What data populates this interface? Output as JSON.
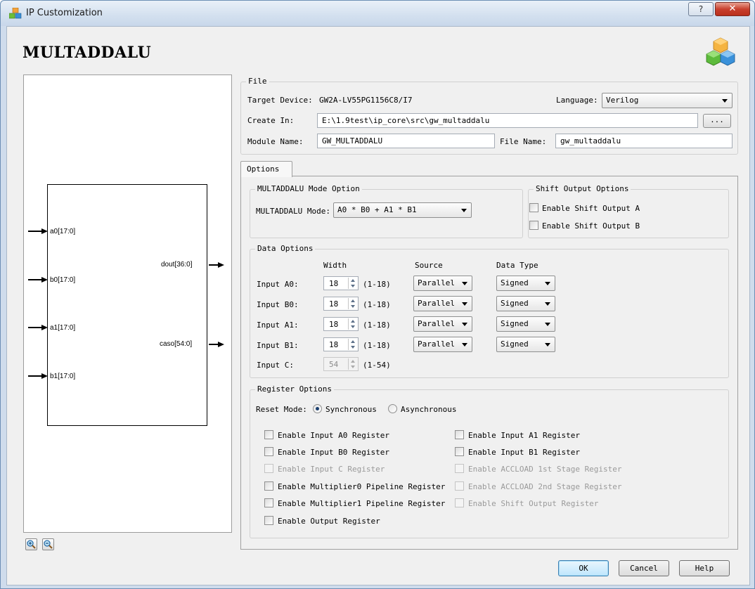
{
  "window": {
    "title": "IP Customization",
    "help_glyph": "?",
    "close_glyph": "✕",
    "icon": "ip-core-icon"
  },
  "header": {
    "title": "MULTADDALU",
    "logo_icon": "cubes-logo-icon"
  },
  "schematic": {
    "inputs": [
      "a0[17:0]",
      "b0[17:0]",
      "a1[17:0]",
      "b1[17:0]"
    ],
    "outputs": [
      "dout[36:0]",
      "caso[54:0]"
    ]
  },
  "file": {
    "group_title": "File",
    "target_device_label": "Target Device:",
    "target_device": "GW2A-LV55PG1156C8/I7",
    "language_label": "Language:",
    "language": "Verilog",
    "create_in_label": "Create In:",
    "create_in": "E:\\1.9test\\ip_core\\src\\gw_multaddalu",
    "browse_label": "...",
    "module_name_label": "Module Name:",
    "module_name": "GW_MULTADDALU",
    "file_name_label": "File Name:",
    "file_name": "gw_multaddalu"
  },
  "tabs": [
    {
      "label": "Options"
    }
  ],
  "mode": {
    "group_title": "MULTADDALU Mode Option",
    "label": "MULTADDALU Mode:",
    "value": "A0 * B0 + A1 * B1"
  },
  "shift": {
    "group_title": "Shift Output Options",
    "a_label": "Enable Shift Output A",
    "b_label": "Enable Shift Output B"
  },
  "data_options": {
    "group_title": "Data Options",
    "headers": {
      "width": "Width",
      "source": "Source",
      "type": "Data Type"
    },
    "rows": [
      {
        "label": "Input A0:",
        "width": "18",
        "range": "(1-18)",
        "source": "Parallel",
        "type": "Signed"
      },
      {
        "label": "Input B0:",
        "width": "18",
        "range": "(1-18)",
        "source": "Parallel",
        "type": "Signed"
      },
      {
        "label": "Input A1:",
        "width": "18",
        "range": "(1-18)",
        "source": "Parallel",
        "type": "Signed"
      },
      {
        "label": "Input B1:",
        "width": "18",
        "range": "(1-18)",
        "source": "Parallel",
        "type": "Signed"
      },
      {
        "label": "Input C:",
        "width": "54",
        "range": "(1-54)"
      }
    ]
  },
  "register_options": {
    "group_title": "Register Options",
    "reset_label": "Reset Mode:",
    "sync_label": "Synchronous",
    "async_label": "Asynchronous",
    "left": [
      {
        "label": "Enable Input A0 Register",
        "enabled": true
      },
      {
        "label": "Enable Input B0 Register",
        "enabled": true
      },
      {
        "label": "Enable Input C Register",
        "enabled": false
      },
      {
        "label": "Enable Multiplier0 Pipeline Register",
        "enabled": true
      },
      {
        "label": "Enable Multiplier1 Pipeline Register",
        "enabled": true
      },
      {
        "label": "Enable Output Register",
        "enabled": true
      }
    ],
    "right": [
      {
        "label": "Enable Input A1 Register",
        "enabled": true
      },
      {
        "label": "Enable Input B1 Register",
        "enabled": true
      },
      {
        "label": "Enable ACCLOAD 1st Stage Register",
        "enabled": false
      },
      {
        "label": "Enable ACCLOAD 2nd Stage Register",
        "enabled": false
      },
      {
        "label": "Enable Shift Output Register",
        "enabled": false
      }
    ]
  },
  "buttons": {
    "ok": "OK",
    "cancel": "Cancel",
    "help": "Help"
  },
  "zoom": {
    "in_icon": "zoom-in-icon",
    "out_icon": "zoom-out-icon"
  }
}
